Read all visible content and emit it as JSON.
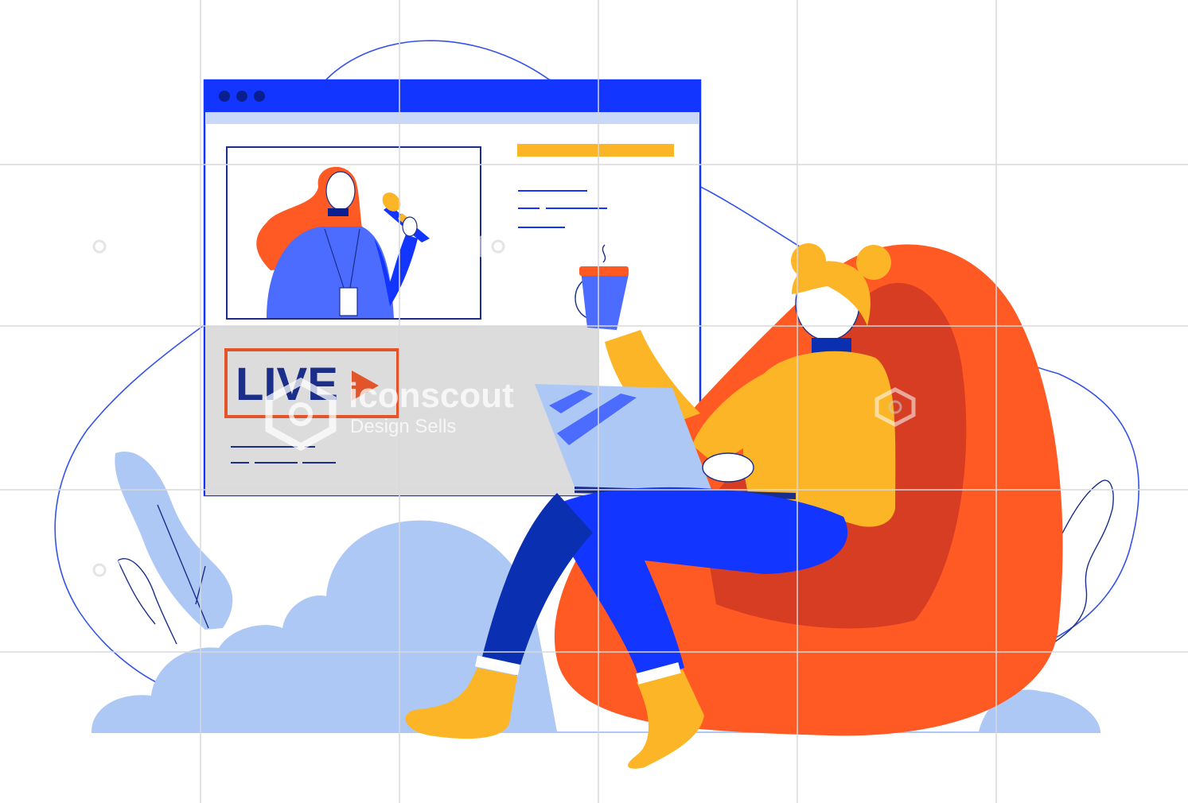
{
  "live_card": {
    "label": "LIVE"
  },
  "watermark": {
    "brand": "iconscout",
    "tagline": "Design Sells"
  },
  "colors": {
    "blue_primary": "#1236ff",
    "blue_dark": "#0a2fb0",
    "blue_light": "#aec8f5",
    "orange": "#ff5a23",
    "orange_dark": "#d63d22",
    "yellow": "#fbb526",
    "window_bar_light": "#c9d7f8",
    "overlay_gray": "#dcdcdc",
    "live_border": "#e2552b"
  },
  "icons": [
    "window-dot-icon",
    "play-icon",
    "iconscout-hex-icon",
    "steam-icon"
  ]
}
